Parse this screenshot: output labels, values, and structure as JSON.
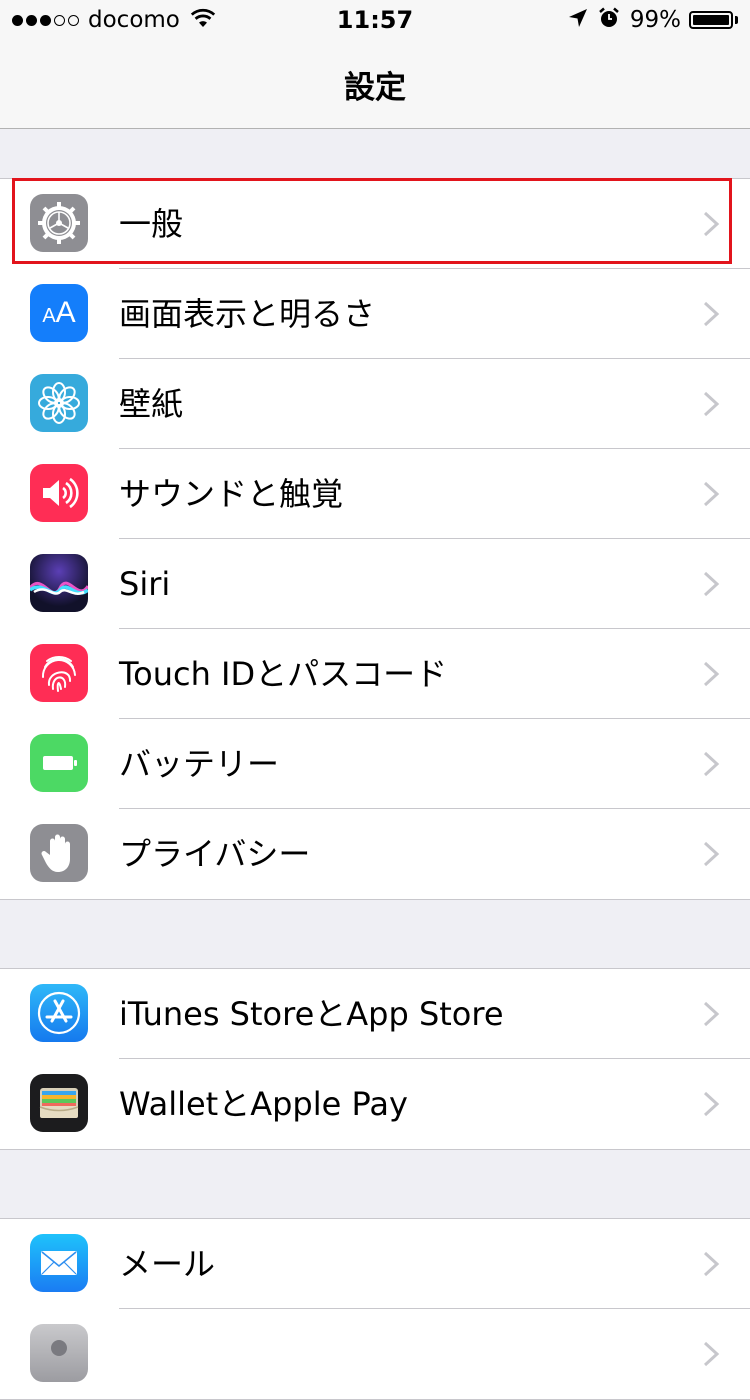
{
  "status_bar": {
    "carrier": "docomo",
    "time": "11:57",
    "battery": "99%",
    "battery_level": 0.99,
    "signal_bars": 3,
    "icons": [
      "signal-dots-icon",
      "wifi-icon",
      "location-arrow-icon",
      "alarm-icon",
      "battery-icon"
    ]
  },
  "nav": {
    "title": "設定"
  },
  "groups": [
    {
      "items": [
        {
          "label": "一般",
          "icon": "gear-icon",
          "color": "#8e8e93",
          "selected": true
        },
        {
          "label": "画面表示と明るさ",
          "icon": "text-size-icon",
          "color": "#147efb"
        },
        {
          "label": "壁紙",
          "icon": "flower-icon",
          "color": "#36aadc"
        },
        {
          "label": "サウンドと触覚",
          "icon": "speaker-icon",
          "color": "#ff2d55"
        },
        {
          "label": "Siri",
          "icon": "siri-icon",
          "color": "#1a1a40"
        },
        {
          "label": "Touch IDとパスコード",
          "icon": "fingerprint-icon",
          "color": "#ff2d55"
        },
        {
          "label": "バッテリー",
          "icon": "battery-icon",
          "color": "#4cd964"
        },
        {
          "label": "プライバシー",
          "icon": "hand-icon",
          "color": "#8e8e93"
        }
      ]
    },
    {
      "items": [
        {
          "label": "iTunes StoreとApp Store",
          "icon": "app-store-icon",
          "color": "#1e8ef5"
        },
        {
          "label": "WalletとApple Pay",
          "icon": "wallet-icon",
          "color": "#1c1c1e"
        }
      ]
    },
    {
      "items": [
        {
          "label": "メール",
          "icon": "mail-icon",
          "color": "#1e8ef5"
        },
        {
          "label": "",
          "icon": "contacts-icon",
          "color": "#b4b4b8"
        }
      ]
    }
  ]
}
